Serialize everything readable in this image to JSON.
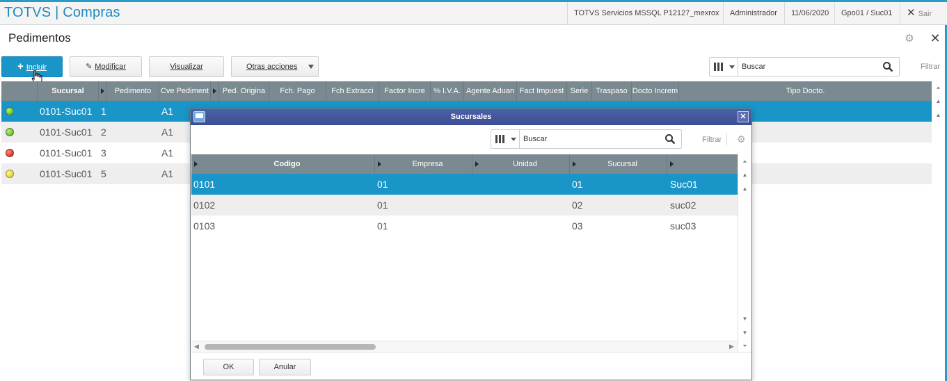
{
  "app": {
    "title": "TOTVS | Compras",
    "server": "TOTVS Servicios MSSQL P12127_mexrox",
    "user": "Administrador",
    "date": "11/06/2020",
    "group": "Gpo01 / Suc01",
    "exit_label": "Sair"
  },
  "page": {
    "title": "Pedimentos"
  },
  "toolbar": {
    "incluir": "Incluir",
    "modificar": "Modificar",
    "visualizar": "Visualizar",
    "otras": "Otras acciones"
  },
  "search": {
    "placeholder": "Buscar",
    "filter_label": "Filtrar"
  },
  "grid": {
    "headers": [
      "Sucursal",
      "Pedimento",
      "Cve Pediment",
      "Ped. Origina",
      "Fch. Pago",
      "Fch Extracci",
      "Factor Incre",
      "% I.V.A.",
      "Agente Aduan",
      "Fact Impuest",
      "Serie",
      "Traspaso",
      "Docto Increm",
      "Tipo Docto."
    ],
    "rows": [
      {
        "status": "green",
        "sucursal": "0101-Suc01",
        "pedimento": "1",
        "cve": "A1"
      },
      {
        "status": "green",
        "sucursal": "0101-Suc01",
        "pedimento": "2",
        "cve": "A1"
      },
      {
        "status": "red",
        "sucursal": "0101-Suc01",
        "pedimento": "3",
        "cve": "A1"
      },
      {
        "status": "yellow",
        "sucursal": "0101-Suc01",
        "pedimento": "5",
        "cve": "A1"
      }
    ]
  },
  "modal": {
    "title": "Sucursales",
    "search_placeholder": "Buscar",
    "filter_label": "Filtrar",
    "headers": [
      "Codigo",
      "Empresa",
      "Unidad",
      "Sucursal"
    ],
    "rows": [
      {
        "codigo": "0101",
        "empresa": "01",
        "unidad": "",
        "sucursal": "01",
        "nombre": "Suc01"
      },
      {
        "codigo": "0102",
        "empresa": "01",
        "unidad": "",
        "sucursal": "02",
        "nombre": "suc02"
      },
      {
        "codigo": "0103",
        "empresa": "01",
        "unidad": "",
        "sucursal": "03",
        "nombre": "suc03"
      }
    ],
    "ok_label": "OK",
    "cancel_label": "Anular"
  },
  "colors": {
    "accent": "#1a95c8",
    "header_gray": "#7a8a90",
    "modal_title": "#4b5fa8"
  }
}
